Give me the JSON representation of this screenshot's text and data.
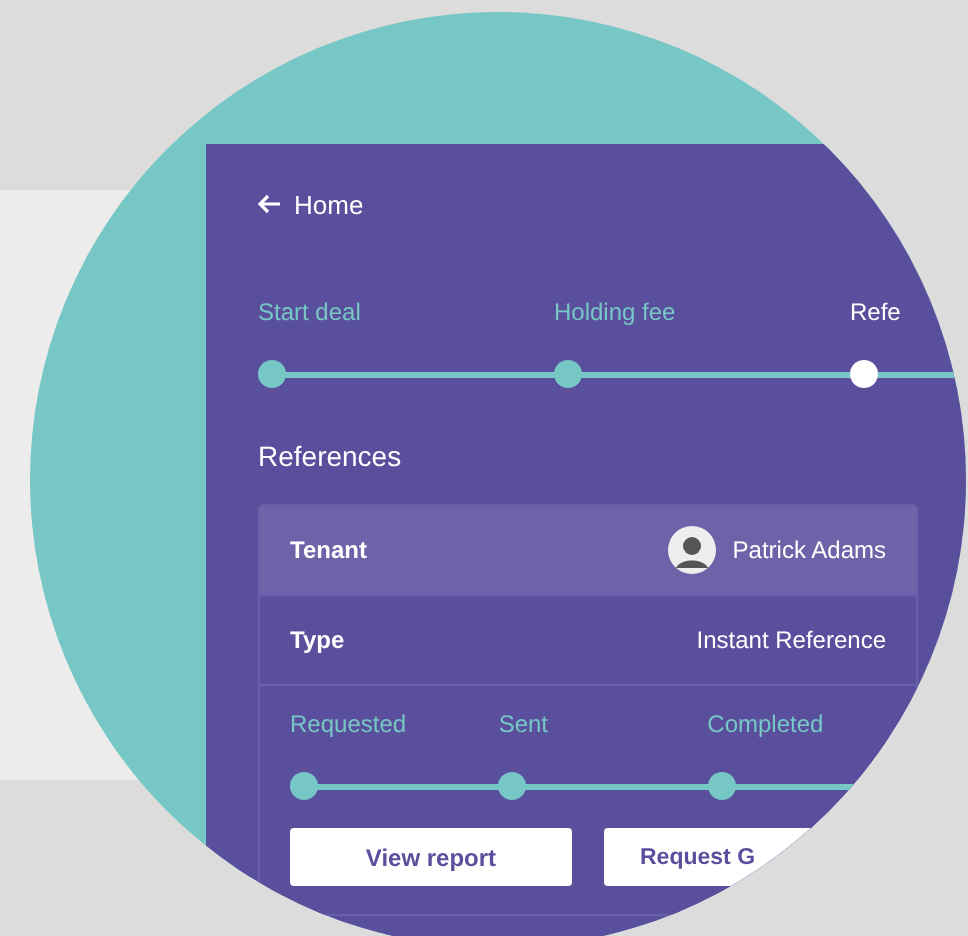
{
  "nav": {
    "back_label": "Home"
  },
  "deal_steps": [
    {
      "label": "Start deal",
      "done": true
    },
    {
      "label": "Holding fee",
      "done": true
    },
    {
      "label": "Refe",
      "done": false
    }
  ],
  "section_title": "References",
  "reference": {
    "rows": [
      {
        "label": "Tenant",
        "value": "Patrick Adams",
        "kind": "person"
      },
      {
        "label": "Type",
        "value": "Instant Reference",
        "kind": "text"
      }
    ],
    "steps": [
      {
        "label": "Requested",
        "done": true
      },
      {
        "label": "Sent",
        "done": true
      },
      {
        "label": "Completed",
        "done": true
      }
    ],
    "buttons": [
      "View report",
      "Request G"
    ]
  }
}
